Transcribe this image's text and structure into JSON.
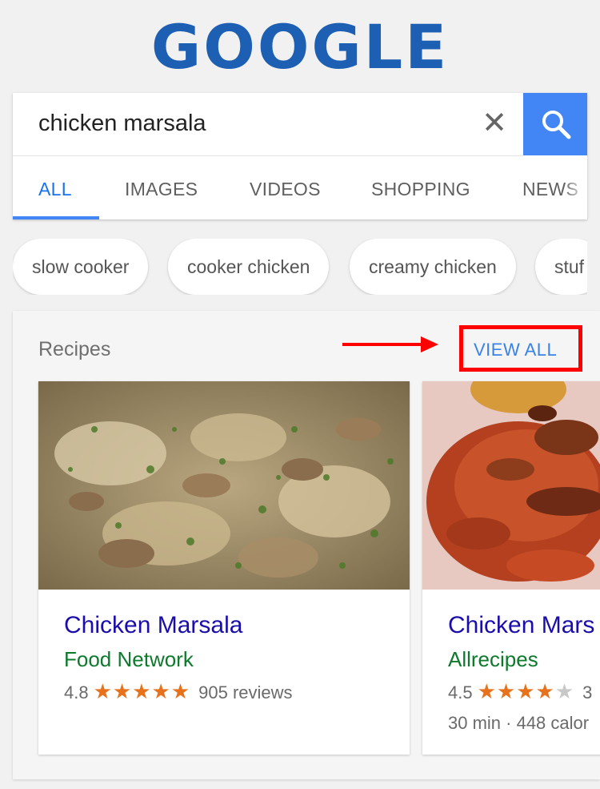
{
  "logo": {
    "text": "GOOGLE"
  },
  "search": {
    "query": "chicken marsala",
    "clear_glyph": "✕"
  },
  "tabs": [
    {
      "label": "ALL",
      "active": true
    },
    {
      "label": "IMAGES",
      "active": false
    },
    {
      "label": "VIDEOS",
      "active": false
    },
    {
      "label": "SHOPPING",
      "active": false
    },
    {
      "label": "NEWS",
      "active": false
    }
  ],
  "chips": [
    "slow cooker",
    "cooker chicken",
    "creamy chicken",
    "stuf"
  ],
  "recipes": {
    "heading": "Recipes",
    "view_all": "VIEW ALL",
    "cards": [
      {
        "title": "Chicken Marsala",
        "source": "Food Network",
        "rating": "4.8",
        "stars": 4.8,
        "reviews": "905 reviews",
        "meta": ""
      },
      {
        "title": "Chicken Mars",
        "source": "Allrecipes",
        "rating": "4.5",
        "stars": 4.5,
        "reviews": "3",
        "meta": "30 min · 448 calor"
      }
    ]
  },
  "colors": {
    "brand_blue": "#1d5fb3",
    "search_button": "#4285f4",
    "link_title": "#1a0dab",
    "source_green": "#0d7a2c",
    "star_orange": "#e8711c",
    "annotation_red": "#ff0000"
  },
  "icons": {
    "search": "search-icon",
    "clear": "close-icon",
    "arrow": "red-arrow-annotation"
  }
}
